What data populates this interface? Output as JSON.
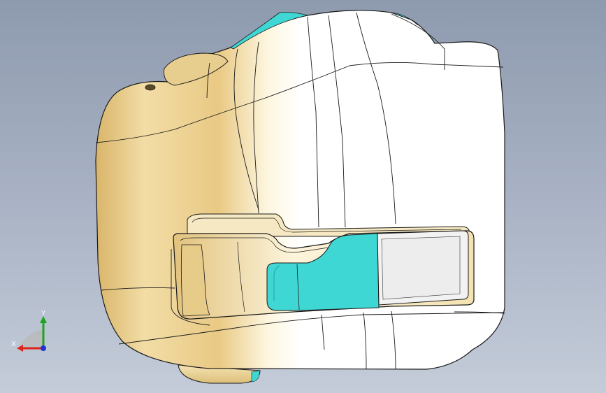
{
  "viewport": {
    "background_top": "#8e9aae",
    "background_bottom": "#c4ccd9"
  },
  "model": {
    "name": "tape-measure-housing",
    "body_color": "#ecd9a0",
    "highlight_color": "#ffffff",
    "shadow_color": "#c9a75c",
    "accent_color": "#3fd7d3",
    "edge_color": "#1a1a1a"
  },
  "triad": {
    "x_label": "X",
    "y_label": "Y",
    "x_color": "#e0241c",
    "y_color": "#1ea51e",
    "z_color": "#1c34d8"
  }
}
